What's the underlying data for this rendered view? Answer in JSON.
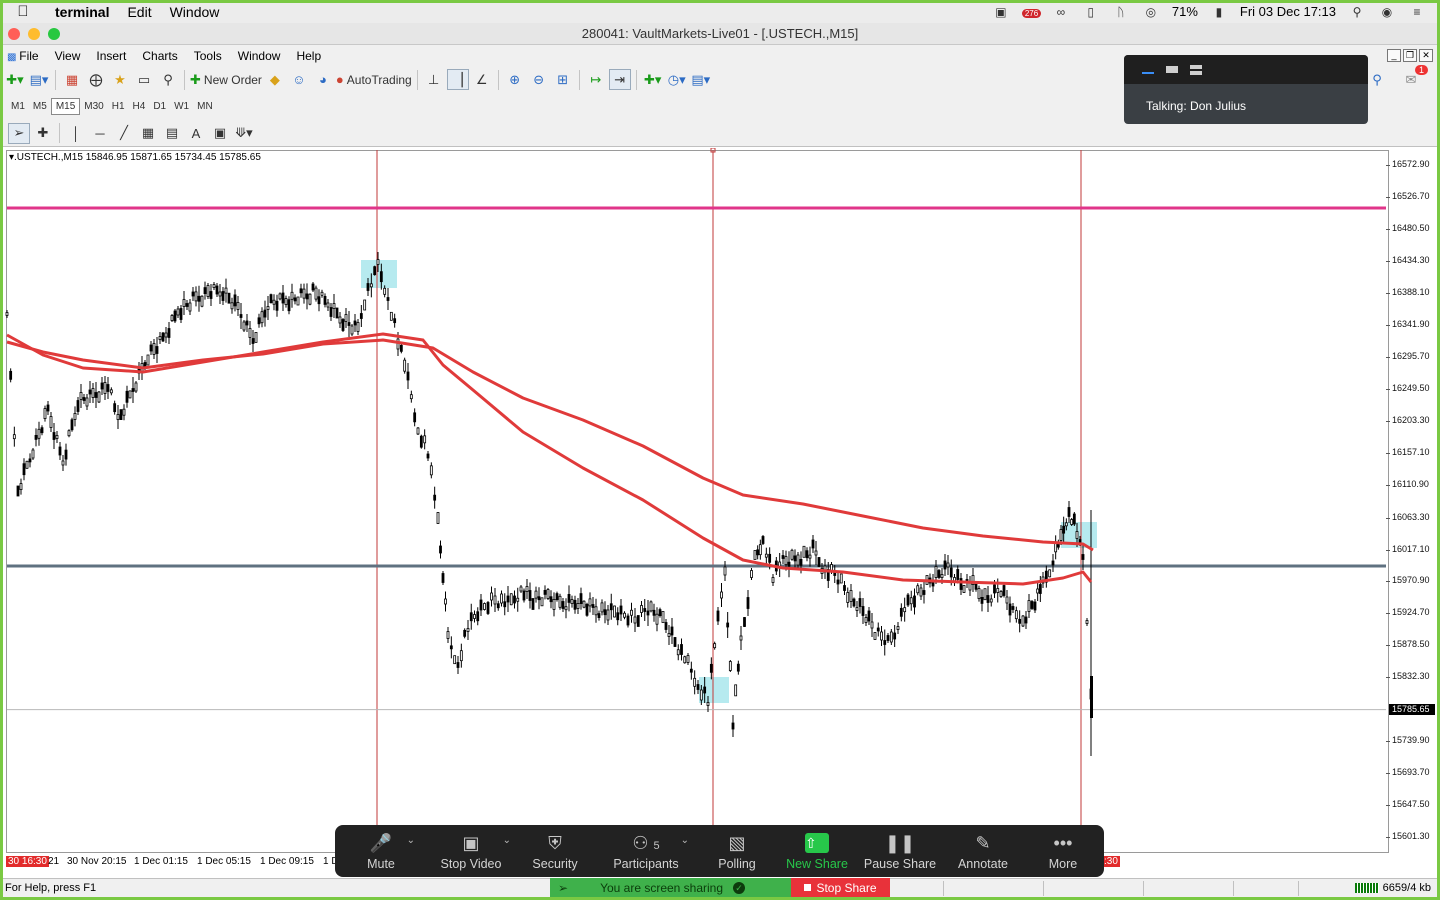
{
  "menubar": {
    "app": "terminal",
    "items": [
      "Edit",
      "Window"
    ],
    "badge": "276",
    "battery": "71%",
    "datetime": "Fri 03 Dec  17:13"
  },
  "window": {
    "title": "280041: VaultMarkets-Live01 - [.USTECH.,M15]"
  },
  "mt_menu": {
    "items": [
      "File",
      "View",
      "Insert",
      "Charts",
      "Tools",
      "Window",
      "Help"
    ]
  },
  "toolbar": {
    "new_order": "New Order",
    "autotrading": "AutoTrading",
    "timeframes": [
      "M1",
      "M5",
      "M15",
      "M30",
      "H1",
      "H4",
      "D1",
      "W1",
      "MN"
    ],
    "active_timeframe": "M15",
    "alert_count": "1"
  },
  "chart": {
    "info": ".USTECH.,M15  15846.95 15871.65 15734.45 15785.65",
    "symbol": ".USTECH.",
    "timeframe": "M15",
    "ohlc": {
      "open": 15846.95,
      "high": 15871.65,
      "low": 15734.45,
      "close": 15785.65
    },
    "current_price": "15785.65",
    "price_labels": [
      "16572.90",
      "16526.70",
      "16480.50",
      "16434.30",
      "16388.10",
      "16341.90",
      "16295.70",
      "16249.50",
      "16203.30",
      "16157.10",
      "16110.90",
      "16063.30",
      "16017.10",
      "15970.90",
      "15924.70",
      "15878.50",
      "15832.30",
      "15785.65",
      "15739.90",
      "15693.70",
      "15647.50",
      "15601.30"
    ],
    "time_labels": {
      "left_marker": "30 16:30",
      "items": [
        "21",
        "30 Nov 20:15",
        "1 Dec 01:15",
        "1 Dec 05:15",
        "1 Dec 09:15",
        "1 D"
      ],
      "right_marker": ":30"
    },
    "colors": {
      "pink_line": "#e0358a",
      "slate_line": "#5f7180",
      "ma_red": "#e03a3a",
      "vline": "#c23a3a",
      "zone": "#9ee3ea"
    }
  },
  "status": {
    "help": "For Help, press F1",
    "traffic": "6659/4 kb"
  },
  "talk_panel": {
    "text": "Talking: Don Julius"
  },
  "zoom": {
    "buttons": [
      {
        "id": "mute",
        "label": "Mute",
        "icon": "microphone-icon"
      },
      {
        "id": "stop-video",
        "label": "Stop Video",
        "icon": "video-camera-icon"
      },
      {
        "id": "security",
        "label": "Security",
        "icon": "shield-icon"
      },
      {
        "id": "participants",
        "label": "Participants",
        "icon": "participants-icon",
        "count": "5"
      },
      {
        "id": "polling",
        "label": "Polling",
        "icon": "bar-chart-icon"
      },
      {
        "id": "new-share",
        "label": "New Share",
        "icon": "share-arrow-icon"
      },
      {
        "id": "pause-share",
        "label": "Pause Share",
        "icon": "pause-icon"
      },
      {
        "id": "annotate",
        "label": "Annotate",
        "icon": "pencil-icon"
      },
      {
        "id": "more",
        "label": "More",
        "icon": "more-dots-icon"
      }
    ],
    "sharing_text": "You are screen sharing",
    "stop_share": "Stop Share"
  }
}
